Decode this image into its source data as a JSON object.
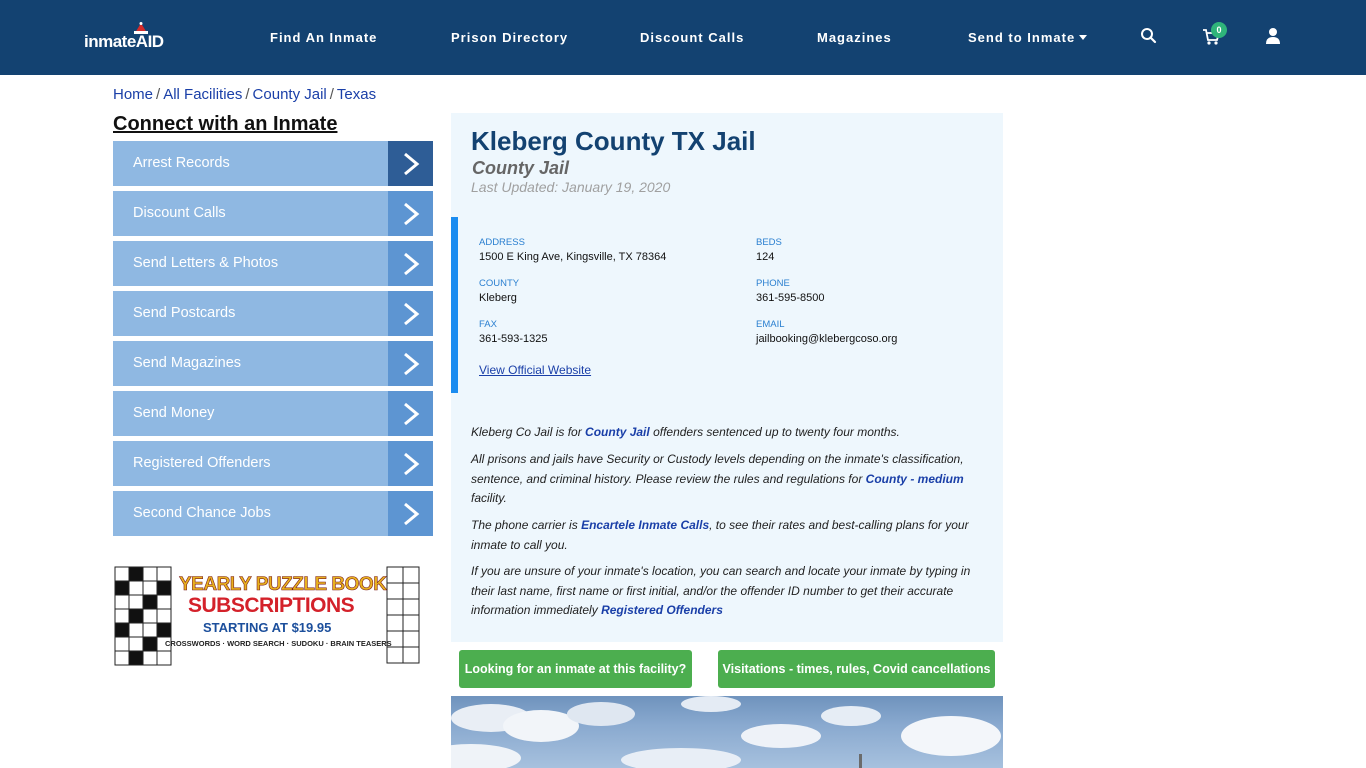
{
  "header": {
    "logo_text": "inmateAID",
    "nav": [
      {
        "label": "Find An Inmate"
      },
      {
        "label": "Prison Directory"
      },
      {
        "label": "Discount Calls"
      },
      {
        "label": "Magazines"
      },
      {
        "label": "Send to Inmate"
      }
    ],
    "cart_count": "0",
    "icons": [
      "search-icon",
      "cart-icon",
      "user-icon"
    ]
  },
  "breadcrumb": [
    {
      "label": "Home"
    },
    {
      "label": "All Facilities"
    },
    {
      "label": "County Jail"
    },
    {
      "label": "Texas"
    }
  ],
  "sidebar": {
    "title": "Connect with an Inmate",
    "items": [
      {
        "label": "Arrest Records"
      },
      {
        "label": "Discount Calls"
      },
      {
        "label": "Send Letters & Photos"
      },
      {
        "label": "Send Postcards"
      },
      {
        "label": "Send Magazines"
      },
      {
        "label": "Send Money"
      },
      {
        "label": "Registered Offenders"
      },
      {
        "label": "Second Chance Jobs"
      }
    ],
    "ad": {
      "line1": "YEARLY PUZZLE BOOK",
      "line2": "SUBSCRIPTIONS",
      "line3": "STARTING AT $19.95",
      "line4": "CROSSWORDS · WORD SEARCH · SUDOKU · BRAIN TEASERS"
    }
  },
  "facility": {
    "name": "Kleberg County TX Jail",
    "type": "County Jail",
    "last_updated": "Last Updated: January 19, 2020",
    "fields": {
      "address_label": "ADDRESS",
      "address": "1500 E King Ave, Kingsville, TX 78364",
      "beds_label": "BEDS",
      "beds": "124",
      "county_label": "COUNTY",
      "county": "Kleberg",
      "phone_label": "PHONE",
      "phone": "361-595-8500",
      "fax_label": "FAX",
      "fax": "361-593-1325",
      "email_label": "EMAIL",
      "email": "jailbooking@klebergcoso.org"
    },
    "website_link": "View Official Website"
  },
  "description": {
    "p1_a": "Kleberg Co Jail is for ",
    "p1_link": "County Jail",
    "p1_b": " offenders sentenced up to twenty four months.",
    "p2_a": "All prisons and jails have Security or Custody levels depending on the inmate's classification, sentence, and criminal history. Please review the rules and regulations for ",
    "p2_link": "County - medium",
    "p2_b": " facility.",
    "p3_a": "The phone carrier is ",
    "p3_link": "Encartele Inmate Calls",
    "p3_b": ", to see their rates and best-calling plans for your inmate to call you.",
    "p4_a": "If you are unsure of your inmate's location, you can search and locate your inmate by typing in their last name, first name or first initial, and/or the offender ID number to get their accurate information immediately ",
    "p4_link": "Registered Offenders"
  },
  "buttons": {
    "find_inmate": "Looking for an inmate at this facility?",
    "visitations": "Visitations - times, rules, Covid cancellations"
  },
  "colors": {
    "header_bg": "#134271",
    "sidebar_btn": "#8fb8e2",
    "sidebar_arrow": "#5d95d2",
    "panel_bg": "#eef7fd",
    "accent_bar": "#1b8cf0",
    "green_btn": "#4cae4f"
  }
}
